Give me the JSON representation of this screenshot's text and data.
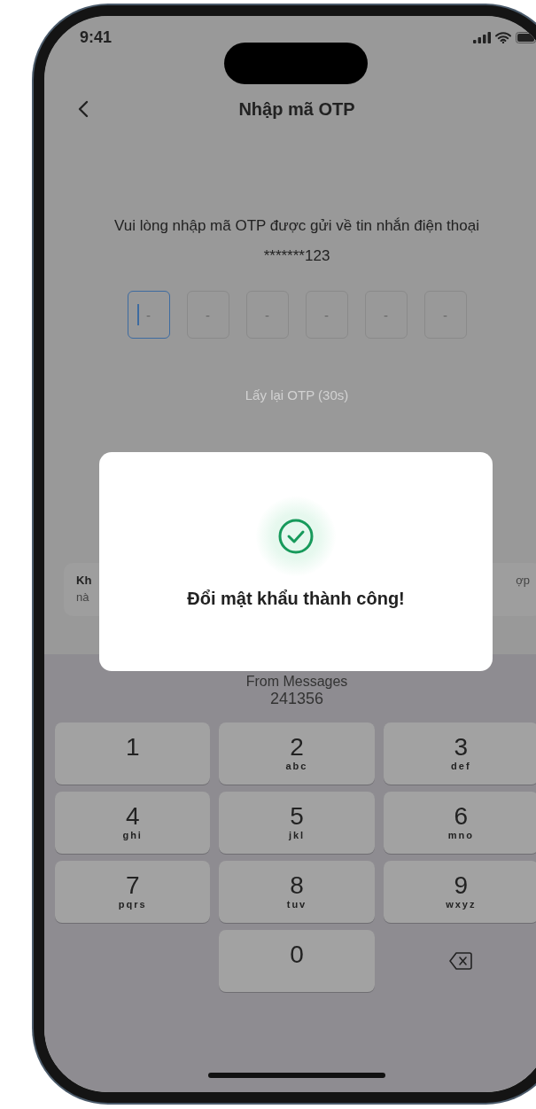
{
  "status_bar": {
    "time": "9:41"
  },
  "nav": {
    "title": "Nhập mã OTP"
  },
  "instruction": "Vui lòng nhập mã OTP được gửi về tin nhắn điện thoại *******123",
  "otp_boxes": [
    {
      "placeholder": "-",
      "selected": true
    },
    {
      "placeholder": "-",
      "selected": false
    },
    {
      "placeholder": "-",
      "selected": false
    },
    {
      "placeholder": "-",
      "selected": false
    },
    {
      "placeholder": "-",
      "selected": false
    },
    {
      "placeholder": "-",
      "selected": false
    }
  ],
  "resend": "Lấy lại OTP (30s)",
  "note_card": {
    "left_line_1": "Kh",
    "left_line_2": "nà",
    "right_line_1": "ợp"
  },
  "dialog": {
    "message": "Đổi mật khẩu thành công!"
  },
  "keyboard": {
    "suggestion_source": "From Messages",
    "suggestion_code": "241356",
    "keys": [
      {
        "kind": "digit",
        "digit": "1"
      },
      {
        "kind": "digit",
        "digit": "2",
        "letters": "abc"
      },
      {
        "kind": "digit",
        "digit": "3",
        "letters": "def"
      },
      {
        "kind": "digit",
        "digit": "4",
        "letters": "ghi"
      },
      {
        "kind": "digit",
        "digit": "5",
        "letters": "jkl"
      },
      {
        "kind": "digit",
        "digit": "6",
        "letters": "mno"
      },
      {
        "kind": "digit",
        "digit": "7",
        "letters": "pqrs"
      },
      {
        "kind": "digit",
        "digit": "8",
        "letters": "tuv"
      },
      {
        "kind": "digit",
        "digit": "9",
        "letters": "wxyz"
      },
      {
        "kind": "empty"
      },
      {
        "kind": "digit",
        "digit": "0"
      },
      {
        "kind": "delete"
      }
    ]
  }
}
